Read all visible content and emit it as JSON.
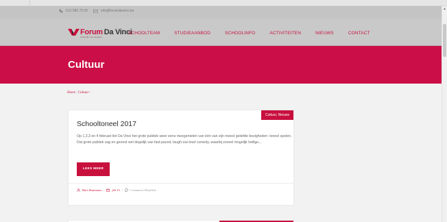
{
  "colors": {
    "brand": "#c8103e",
    "hero": "#cc0e48",
    "header_bg": "#c9c9c9",
    "topbar_bg": "#c4c4c4"
  },
  "topbar": {
    "phone_icon": "phone-icon",
    "phone": "013 580 79 00",
    "mail_icon": "mail-icon",
    "email": "info@forumdavinci.be"
  },
  "header": {
    "logo_part1": "Forum",
    "logo_part2": "Da Vinci",
    "logo_tagline": "onderwijs voor jongeren",
    "nav": [
      {
        "label": "SCHOOLTEAM"
      },
      {
        "label": "STUDIEAANBOD"
      },
      {
        "label": "SCHOOLINFO"
      },
      {
        "label": "ACTIVITEITEN"
      },
      {
        "label": "NIEUWS"
      },
      {
        "label": "CONTACT"
      }
    ]
  },
  "hero": {
    "title": "Cultuur"
  },
  "breadcrumb": {
    "home": "Home",
    "separator": " / ",
    "current": "Cultuur",
    "trailing": " /"
  },
  "post": {
    "categories": "Cultuur, Nieuws",
    "title": "Schooltoneel 2017",
    "excerpt": "Op 1,2,3 en 4 februari liet Da Vinci het grote publiek weer eens meegenieten van één van zijn meest geliefde bezigheden: toneel spelen. Dat grote publiek zag en genoot wel degelijk van fast-paced, laugh-out-loud comedy, waarbij zoveel mogelijk heilige...",
    "read_more": "LEES MEER",
    "author": "Bart Hautmans",
    "date": "feb 15",
    "comments": "Comments Disabled",
    "meta_separator": " / "
  }
}
